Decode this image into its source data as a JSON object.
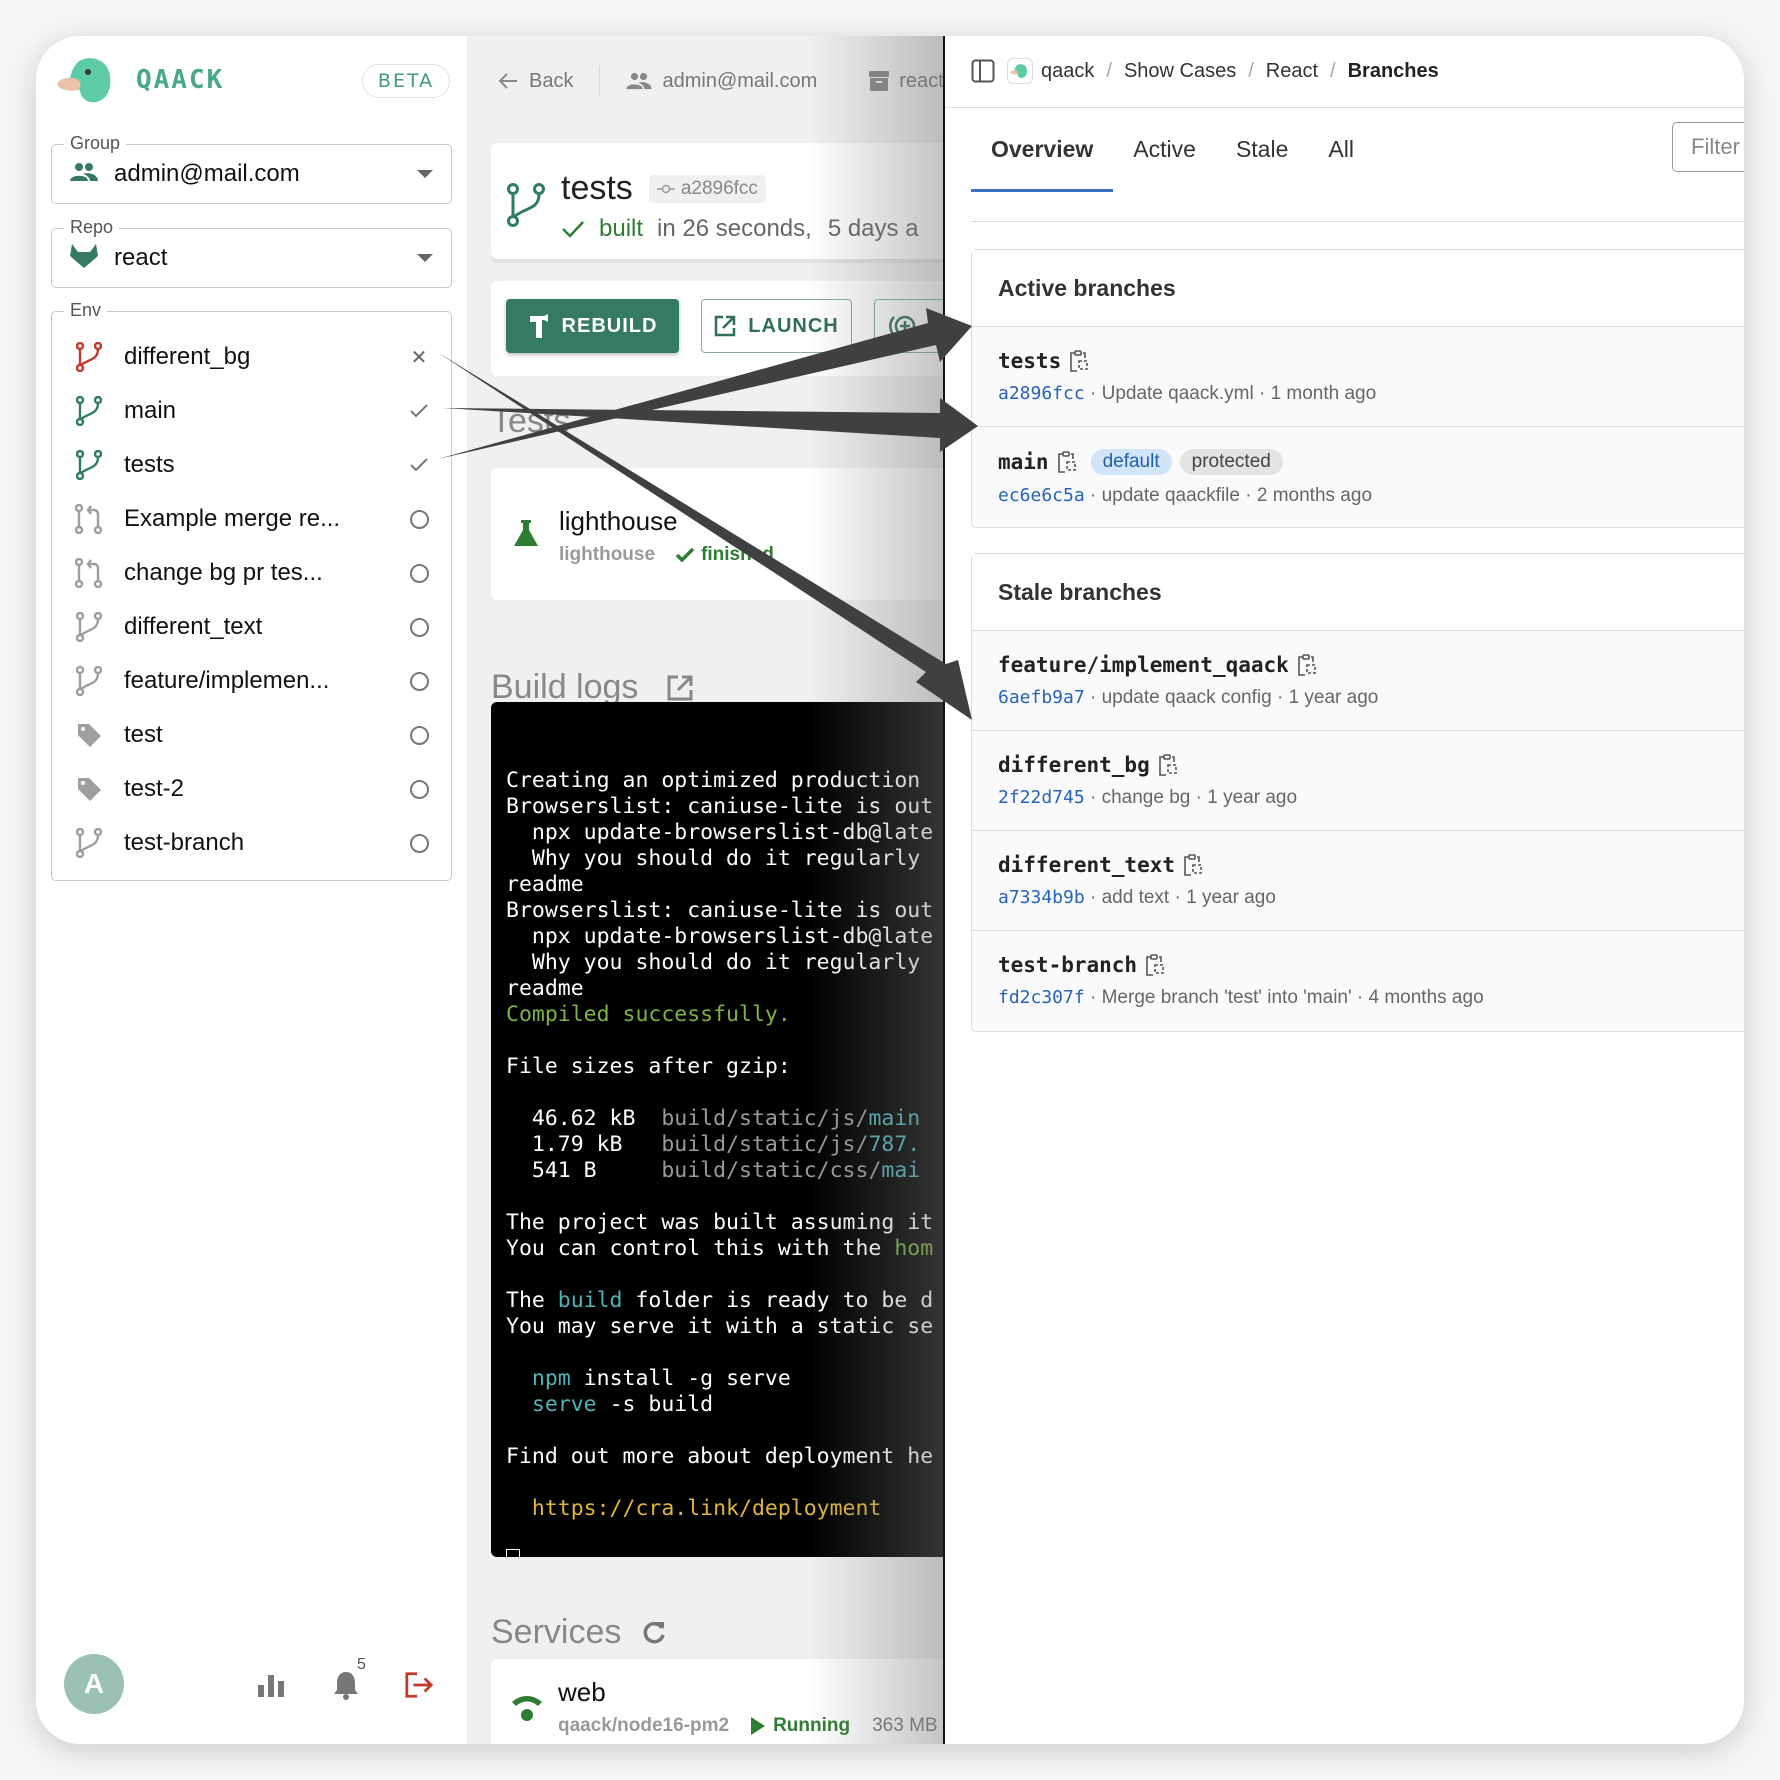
{
  "sidebar": {
    "brand": "QAACK",
    "beta_label": "BETA",
    "group": {
      "legend": "Group",
      "value": "admin@mail.com"
    },
    "repo": {
      "legend": "Repo",
      "value": "react"
    },
    "env": {
      "legend": "Env",
      "items": [
        {
          "label": "different_bg",
          "icon": "branch-icon",
          "icon_color": "#c0392b",
          "status": "failed"
        },
        {
          "label": "main",
          "icon": "branch-icon",
          "icon_color": "#2e7d5e",
          "status": "success"
        },
        {
          "label": "tests",
          "icon": "branch-icon",
          "icon_color": "#2e7d5e",
          "status": "success"
        },
        {
          "label": "Example merge re...",
          "icon": "merge-request-icon",
          "icon_color": "#9e9e9e",
          "status": "none"
        },
        {
          "label": "change bg pr tes...",
          "icon": "merge-request-icon",
          "icon_color": "#9e9e9e",
          "status": "none"
        },
        {
          "label": "different_text",
          "icon": "branch-icon",
          "icon_color": "#9e9e9e",
          "status": "none"
        },
        {
          "label": "feature/implemen...",
          "icon": "branch-icon",
          "icon_color": "#9e9e9e",
          "status": "none"
        },
        {
          "label": "test",
          "icon": "tag-icon",
          "icon_color": "#9e9e9e",
          "status": "none"
        },
        {
          "label": "test-2",
          "icon": "tag-icon",
          "icon_color": "#9e9e9e",
          "status": "none"
        },
        {
          "label": "test-branch",
          "icon": "branch-icon",
          "icon_color": "#9e9e9e",
          "status": "none"
        }
      ]
    },
    "footer": {
      "avatar_initial": "A",
      "notifications_count": "5"
    }
  },
  "main": {
    "topbar": {
      "back_label": "Back",
      "group": "admin@mail.com",
      "repo": "react"
    },
    "build": {
      "branch": "tests",
      "commit": "a2896fcc",
      "status": "built",
      "duration": "in 26 seconds,",
      "age": "5 days a"
    },
    "buttons": {
      "rebuild": "REBUILD",
      "launch": "LAUNCH"
    },
    "tests_heading": "Tests",
    "test": {
      "name": "lighthouse",
      "type": "lighthouse",
      "status": "finished"
    },
    "build_logs_heading": "Build logs",
    "logs": [
      [
        {
          "t": ""
        }
      ],
      [
        {
          "t": "Creating an optimized production"
        }
      ],
      [
        {
          "t": "Browserslist: caniuse-lite is out"
        }
      ],
      [
        {
          "t": "  npx update-browserslist-db@late"
        }
      ],
      [
        {
          "t": "  Why you should do it regularly"
        }
      ],
      [
        {
          "t": "readme"
        }
      ],
      [
        {
          "t": "Browserslist: caniuse-lite is out"
        }
      ],
      [
        {
          "t": "  npx update-browserslist-db@late"
        }
      ],
      [
        {
          "t": "  Why you should do it regularly"
        }
      ],
      [
        {
          "t": "readme"
        }
      ],
      [
        {
          "t": "Compiled successfully.",
          "c": "green"
        }
      ],
      [
        {
          "t": ""
        }
      ],
      [
        {
          "t": "File sizes after gzip:"
        }
      ],
      [
        {
          "t": ""
        }
      ],
      [
        {
          "t": "  46.62 kB  "
        },
        {
          "t": "build/static/js/",
          "c": "gray"
        },
        {
          "t": "main",
          "c": "cyan"
        }
      ],
      [
        {
          "t": "  1.79 kB   "
        },
        {
          "t": "build/static/js/",
          "c": "gray"
        },
        {
          "t": "787.",
          "c": "cyan"
        }
      ],
      [
        {
          "t": "  541 B     "
        },
        {
          "t": "build/static/css/",
          "c": "gray"
        },
        {
          "t": "mai",
          "c": "cyan"
        }
      ],
      [
        {
          "t": ""
        }
      ],
      [
        {
          "t": "The project was built assuming it"
        }
      ],
      [
        {
          "t": "You can control this with the "
        },
        {
          "t": "hom",
          "c": "green"
        }
      ],
      [
        {
          "t": ""
        }
      ],
      [
        {
          "t": "The "
        },
        {
          "t": "build",
          "c": "cyan"
        },
        {
          "t": " folder is ready to be d"
        }
      ],
      [
        {
          "t": "You may serve it with a static se"
        }
      ],
      [
        {
          "t": ""
        }
      ],
      [
        {
          "t": "  "
        },
        {
          "t": "npm",
          "c": "cyan"
        },
        {
          "t": " install -g serve"
        }
      ],
      [
        {
          "t": "  "
        },
        {
          "t": "serve",
          "c": "cyan"
        },
        {
          "t": " -s build"
        }
      ],
      [
        {
          "t": ""
        }
      ],
      [
        {
          "t": "Find out more about deployment he"
        }
      ],
      [
        {
          "t": ""
        }
      ],
      [
        {
          "t": "  "
        },
        {
          "t": "https://cra.link/deployment",
          "c": "yel"
        }
      ],
      [
        {
          "t": ""
        }
      ]
    ],
    "services_heading": "Services",
    "service": {
      "name": "web",
      "image": "qaack/node16-pm2",
      "status": "Running",
      "memory": "363 MB"
    }
  },
  "branches_panel": {
    "breadcrumb": [
      "qaack",
      "Show Cases",
      "React",
      "Branches"
    ],
    "tabs": [
      {
        "label": "Overview",
        "active": true
      },
      {
        "label": "Active",
        "active": false
      },
      {
        "label": "Stale",
        "active": false
      },
      {
        "label": "All",
        "active": false
      }
    ],
    "filter_placeholder": "Filter",
    "active_heading": "Active branches",
    "active_branches": [
      {
        "name": "tests",
        "sha": "a2896fcc",
        "message": "Update qaack.yml",
        "age": "1 month ago",
        "badges": []
      },
      {
        "name": "main",
        "sha": "ec6e6c5a",
        "message": "update qaackfile",
        "age": "2 months ago",
        "badges": [
          "default",
          "protected"
        ]
      }
    ],
    "stale_heading": "Stale branches",
    "stale_branches": [
      {
        "name": "feature/implement_qaack",
        "sha": "6aefb9a7",
        "message": "update qaack config",
        "age": "1 year ago"
      },
      {
        "name": "different_bg",
        "sha": "2f22d745",
        "message": "change bg",
        "age": "1 year ago"
      },
      {
        "name": "different_text",
        "sha": "a7334b9b",
        "message": "add text",
        "age": "1 year ago"
      },
      {
        "name": "test-branch",
        "sha": "fd2c307f",
        "message": "Merge branch 'test' into 'main'",
        "age": "4 months ago"
      }
    ]
  },
  "colors": {
    "brand": "#4aa88a",
    "primary": "#357b62",
    "link": "#2563b8",
    "danger": "#c0392b",
    "tab_active": "#3a6fc4"
  }
}
